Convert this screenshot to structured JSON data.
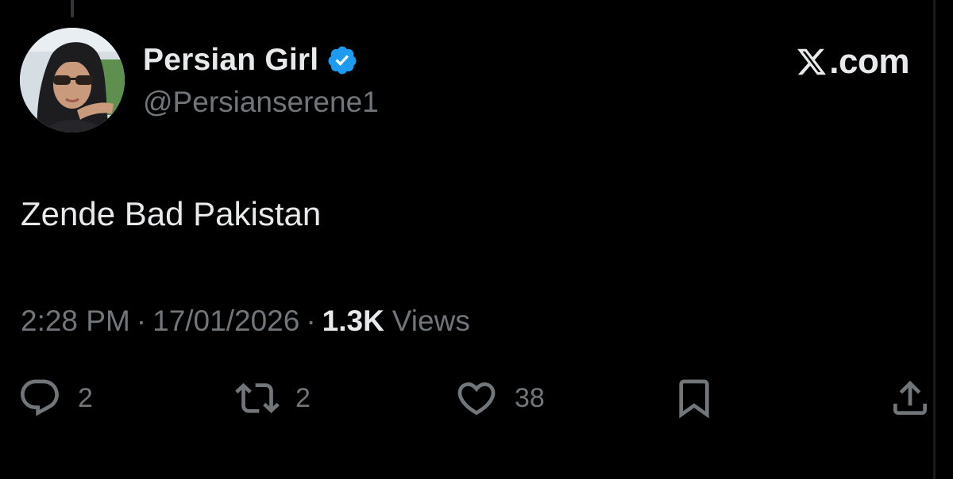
{
  "author": {
    "display_name": "Persian Girl",
    "handle": "@Persianserene1",
    "verified": true,
    "verified_color": "#1d9bf0"
  },
  "brand": {
    "text": ".com",
    "icon": "x-logo-icon"
  },
  "tweet": {
    "text": "Zende Bad Pakistan",
    "time": "2:28 PM",
    "date": "17/01/2026",
    "separator": "·",
    "views_count": "1.3K",
    "views_label": "Views"
  },
  "actions": {
    "reply": {
      "icon": "reply-icon",
      "count": "2"
    },
    "retweet": {
      "icon": "retweet-icon",
      "count": "2"
    },
    "like": {
      "icon": "heart-icon",
      "count": "38"
    },
    "bookmark": {
      "icon": "bookmark-icon"
    },
    "share": {
      "icon": "share-icon"
    }
  },
  "colors": {
    "background": "#000000",
    "primary_text": "#e7e9ea",
    "secondary_text": "#71767b"
  }
}
